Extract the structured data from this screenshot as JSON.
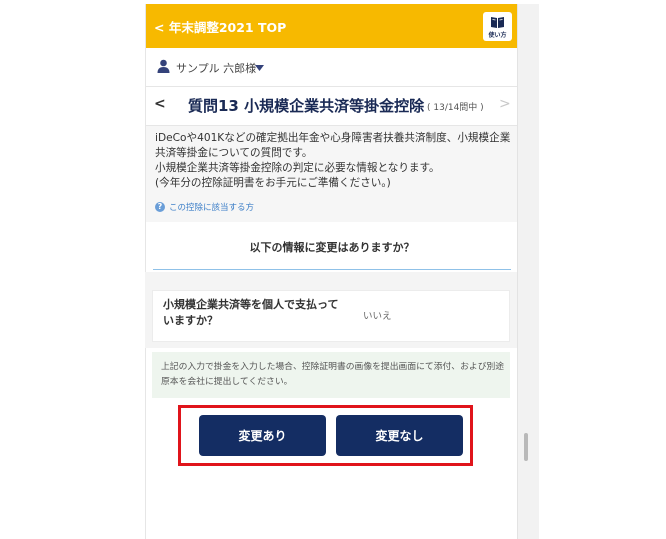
{
  "header": {
    "back_link": "< 年末調整2021 TOP",
    "howto_label": "使い方",
    "brand_color": "#f7b900"
  },
  "user": {
    "name": "サンプル 六郎様",
    "icon": "person-icon",
    "caret_icon": "caret-down-icon"
  },
  "question": {
    "prev_icon": "<",
    "title": "質問13 小規模企業共済等掛金控除",
    "count": "( 13/14問中 )",
    "next_icon": ">"
  },
  "description": {
    "lines": [
      "iDeCoや401Kなどの確定拠出年金や心身障害者扶養共済制度、小規模企業共済等掛金についての質問です。",
      "小規模企業共済等掛金控除の判定に必要な情報となります。",
      "(今年分の控除証明書をお手元にご準備ください。)"
    ],
    "help_link": "この控除に該当する方"
  },
  "prompt": "以下の情報に変更はありますか？",
  "answer": {
    "question": "小規模企業共済等を個人で支払っていますか？",
    "value": "いいえ"
  },
  "note": "上記の入力で掛金を入力した場合、控除証明書の画像を提出画面にて添付、および別途原本を会社に提出してください。",
  "buttons": {
    "change_yes": "変更あり",
    "change_no": "変更なし",
    "color": "#142d63"
  },
  "highlight_color": "#e0141b"
}
